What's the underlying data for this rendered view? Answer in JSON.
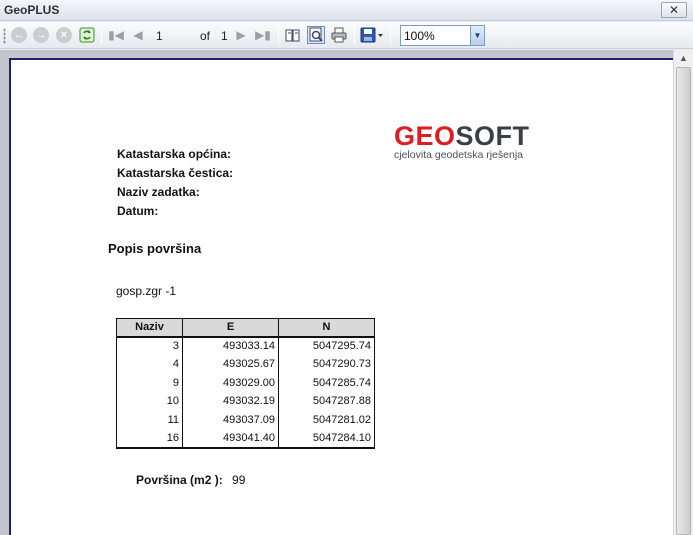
{
  "window": {
    "title": "GeoPLUS",
    "close_glyph": "✕"
  },
  "toolbar": {
    "page_current": "1",
    "of_label": "of",
    "page_total": "1",
    "zoom": "100%",
    "icons": [
      "back-icon",
      "forward-icon",
      "stop-icon",
      "refresh-icon",
      "first-page-icon",
      "previous-page-icon",
      "next-page-icon",
      "last-page-icon",
      "print-layout-icon",
      "page-setup-icon",
      "print-icon",
      "save-icon"
    ]
  },
  "report": {
    "logo": {
      "part1": "GEO",
      "part2": "SOFT",
      "tagline": "cjelovita geodetska rješenja"
    },
    "fields": {
      "municipality": "Katastarska općina:",
      "parcel": "Katastarska čestica:",
      "task": "Naziv zadatka:",
      "date": "Datum:"
    },
    "section_title": "Popis površina",
    "parcel_name": "gosp.zgr -1",
    "table": {
      "headers": [
        "Naziv",
        "E",
        "N"
      ],
      "rows": [
        [
          "3",
          "493033.14",
          "5047295.74"
        ],
        [
          "4",
          "493025.67",
          "5047290.73"
        ],
        [
          "9",
          "493029.00",
          "5047285.74"
        ],
        [
          "10",
          "493032.19",
          "5047287.88"
        ],
        [
          "11",
          "493037.09",
          "5047281.02"
        ],
        [
          "16",
          "493041.40",
          "5047284.10"
        ]
      ]
    },
    "area": {
      "label": "Površina (m2 ):",
      "value": "99"
    }
  }
}
